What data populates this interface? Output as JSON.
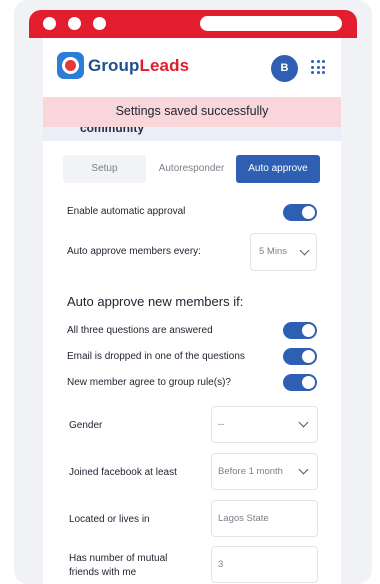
{
  "app": {
    "brand_part1": "Group",
    "brand_part2": "Leads",
    "avatar_initial": "B",
    "brand_colors": {
      "primary": "#2f5fb3",
      "accent": "#e11d2e"
    }
  },
  "toast": {
    "message": "Settings saved successfully"
  },
  "peek_text": "community",
  "tabs": [
    {
      "label": "Setup",
      "active": false
    },
    {
      "label": "Autoresponder",
      "active": false
    },
    {
      "label": "Auto approve",
      "active": true
    }
  ],
  "settings": {
    "enable_label": "Enable automatic approval",
    "enable_on": true,
    "every_label": "Auto approve members every:",
    "every_value": "5 Mins"
  },
  "conditions": {
    "heading": "Auto approve new members if:",
    "items": [
      {
        "label": "All three questions are answered",
        "on": true
      },
      {
        "label": "Email is dropped in one of the questions",
        "on": true
      },
      {
        "label": "New member agree to group rule(s)?",
        "on": true
      }
    ]
  },
  "filters": {
    "gender_label": "Gender",
    "gender_value": "--",
    "joined_label": "Joined facebook at least",
    "joined_value": "Before 1 month",
    "location_label": "Located or lives in",
    "location_value": "Lagos State",
    "mutual_label_line1": "Has number of mutual",
    "mutual_label_line2": "friends with me",
    "mutual_value": "3"
  }
}
